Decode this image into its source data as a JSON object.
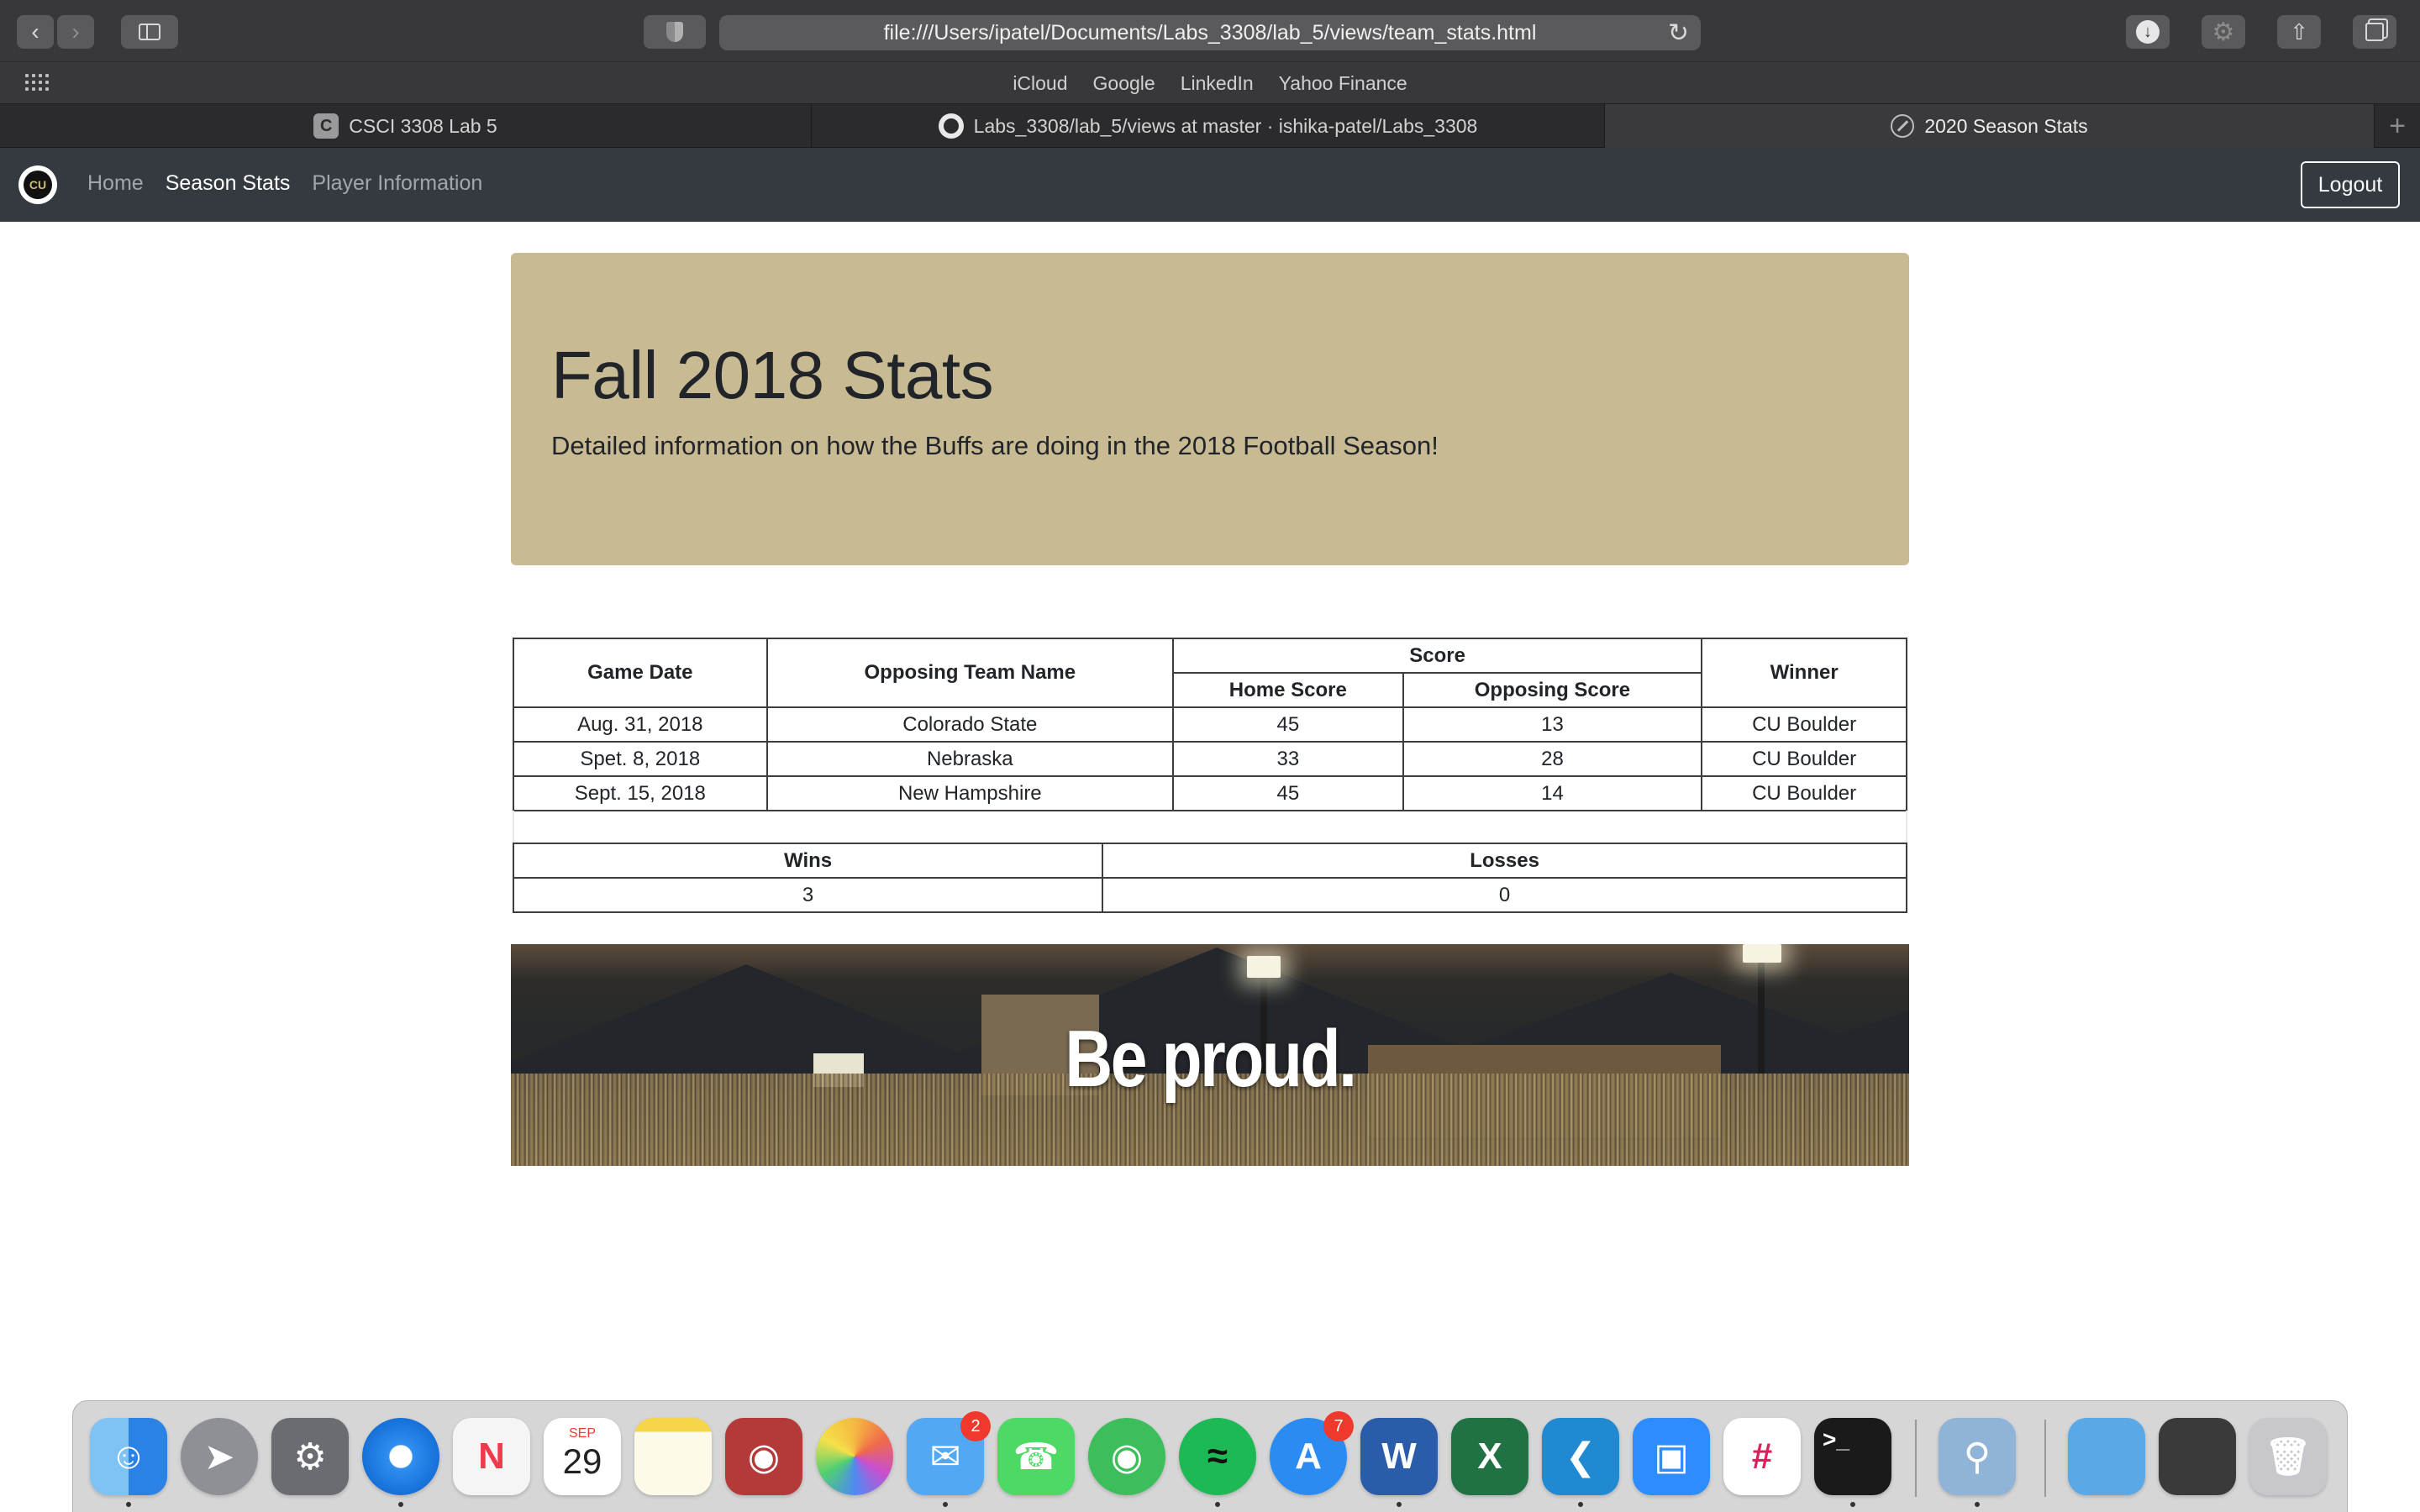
{
  "browser": {
    "url": "file:///Users/ipatel/Documents/Labs_3308/lab_5/views/team_stats.html",
    "favorites": [
      "iCloud",
      "Google",
      "LinkedIn",
      "Yahoo Finance"
    ],
    "tabs": [
      {
        "title": "CSCI 3308 Lab 5",
        "favicon": "C"
      },
      {
        "title": "Labs_3308/lab_5/views at master · ishika-patel/Labs_3308",
        "favicon": "github-icon"
      },
      {
        "title": "2020 Season Stats",
        "favicon": "compass-icon",
        "active": true
      }
    ]
  },
  "nav": {
    "logo": "CU football logo",
    "links": [
      {
        "label": "Home"
      },
      {
        "label": "Season Stats",
        "active": true
      },
      {
        "label": "Player Information"
      }
    ],
    "logout_label": "Logout"
  },
  "jumbotron": {
    "title": "Fall 2018 Stats",
    "lead": "Detailed information on how the Buffs are doing in the 2018 Football Season!"
  },
  "games_table": {
    "headers": {
      "game_date": "Game Date",
      "opposing_team": "Opposing Team Name",
      "score": "Score",
      "home_score": "Home Score",
      "opposing_score": "Opposing Score",
      "winner": "Winner"
    },
    "rows": [
      {
        "date": "Aug. 31, 2018",
        "team": "Colorado State",
        "home": "45",
        "opp": "13",
        "winner": "CU Boulder"
      },
      {
        "date": "Spet. 8, 2018",
        "team": "Nebraska",
        "home": "33",
        "opp": "28",
        "winner": "CU Boulder"
      },
      {
        "date": "Sept. 15, 2018",
        "team": "New Hampshire",
        "home": "45",
        "opp": "14",
        "winner": "CU Boulder"
      }
    ]
  },
  "summary_table": {
    "headers": {
      "wins": "Wins",
      "losses": "Losses"
    },
    "wins": "3",
    "losses": "0"
  },
  "banner": {
    "text": "Be proud."
  },
  "dock": {
    "calendar": {
      "month": "SEP",
      "day": "29"
    },
    "messages_badge": "2",
    "appstore_badge": "7"
  },
  "colors": {
    "jumbotron_bg": "#c8ba93",
    "navbar_bg": "#343a40",
    "browser_chrome": "#38383a"
  }
}
